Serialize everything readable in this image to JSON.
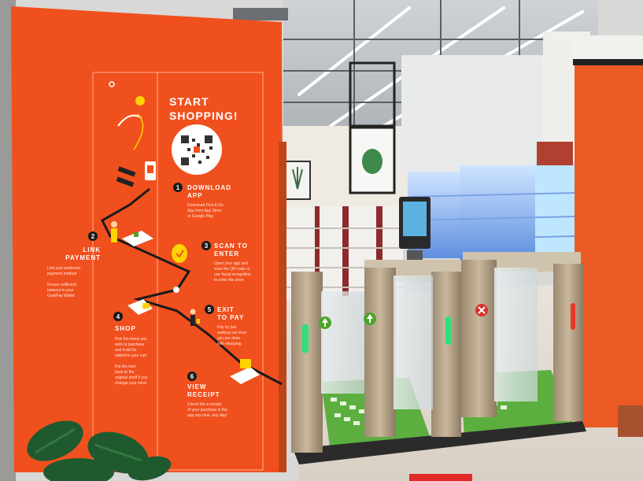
{
  "poster": {
    "title_line1": "START",
    "title_line2": "SHOPPING!",
    "steps": [
      {
        "num": "1",
        "title": [
          "DOWNLOAD",
          "APP"
        ],
        "desc": [
          "Download Pick & Go",
          "App from App Store",
          "or Google Play"
        ]
      },
      {
        "num": "2",
        "title": [
          "LINK",
          "PAYMENT"
        ],
        "desc": [
          "Link your preferred",
          "payment method",
          "",
          "Ensure sufficient",
          "balance in your",
          "GrabPay Wallet"
        ]
      },
      {
        "num": "3",
        "title": [
          "SCAN TO",
          "ENTER"
        ],
        "desc": [
          "Open your app and",
          "scan the QR code or",
          "use facial recognition",
          "to enter the store"
        ]
      },
      {
        "num": "4",
        "title": [
          "SHOP"
        ],
        "desc": [
          "Pick the items you",
          "wish to purchase",
          "and it will be",
          "added to your cart",
          "",
          "Put the item",
          "back to the",
          "original shelf if you",
          "change your mind"
        ]
      },
      {
        "num": "5",
        "title": [
          "EXIT",
          "TO PAY"
        ],
        "desc": [
          "Pay by just",
          "walking out once",
          "you are done",
          "with shopping"
        ]
      },
      {
        "num": "6",
        "title": [
          "VIEW",
          "RECEIPT"
        ],
        "desc": [
          "Check the e-receipt",
          "of your purchase in the",
          "app any time, any day!"
        ]
      }
    ]
  },
  "colors": {
    "wall_orange": "#f0501e",
    "gate_steel": "#b8a58a",
    "floor_green": "#5caf3f",
    "indicator_green": "#2fe07a",
    "indicator_red": "#e8382a"
  },
  "gates": [
    {
      "lane": "left",
      "status": "entry",
      "icon": "green-arrow-icon"
    },
    {
      "lane": "middle",
      "status": "entry",
      "icon": "green-arrow-icon"
    },
    {
      "lane": "right",
      "status": "closed",
      "icon": "red-x-icon"
    }
  ]
}
